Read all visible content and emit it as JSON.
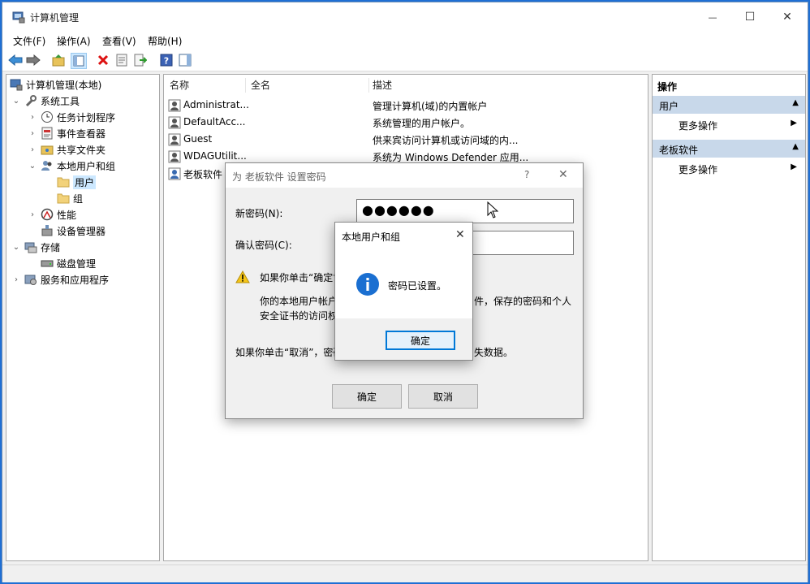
{
  "window": {
    "title": "计算机管理",
    "minimize": "—",
    "maximize": "☐",
    "close": "✕"
  },
  "menu": [
    "文件(F)",
    "操作(A)",
    "查看(V)",
    "帮助(H)"
  ],
  "tree": {
    "root": "计算机管理(本地)",
    "system_tools": "系统工具",
    "task_scheduler": "任务计划程序",
    "event_viewer": "事件查看器",
    "shared_folders": "共享文件夹",
    "local_users_groups": "本地用户和组",
    "users": "用户",
    "groups": "组",
    "performance": "性能",
    "device_manager": "设备管理器",
    "storage": "存储",
    "disk_management": "磁盘管理",
    "services_apps": "服务和应用程序"
  },
  "list": {
    "headers": [
      "名称",
      "全名",
      "描述"
    ],
    "rows": [
      {
        "name": "Administrat...",
        "fullname": "",
        "desc": "管理计算机(域)的内置帐户"
      },
      {
        "name": "DefaultAcc...",
        "fullname": "",
        "desc": "系统管理的用户帐户。"
      },
      {
        "name": "Guest",
        "fullname": "",
        "desc": "供来宾访问计算机或访问域的内..."
      },
      {
        "name": "WDAGUtilit...",
        "fullname": "",
        "desc": "系统为 Windows Defender 应用..."
      },
      {
        "name": "老板软件",
        "fullname": "",
        "desc": ""
      }
    ]
  },
  "actions": {
    "header": "操作",
    "section1": "用户",
    "more1": "更多操作",
    "section2": "老板软件",
    "more2": "更多操作"
  },
  "set_password_dialog": {
    "title": "为 老板软件 设置密码",
    "help": "?",
    "close": "✕",
    "new_password_label": "新密码(N):",
    "new_password_value": "●●●●●●",
    "confirm_label": "确认密码(C):",
    "confirm_value": "",
    "warning_line": "如果你单击“确定”",
    "info_line1_left": "你的本地用户帐户",
    "info_line1_right": "件，保存的密码和个人",
    "info_line2": "安全证书的访问权",
    "cancel_line_left": "如果你单击“取消”，密码",
    "cancel_line_right": "失数据。",
    "ok": "确定",
    "cancel": "取消"
  },
  "message_dialog": {
    "title": "本地用户和组",
    "close": "✕",
    "message": "密码已设置。",
    "ok": "确定"
  },
  "colors": {
    "accent": "#1f6fd4",
    "info_blue": "#1a6fd1",
    "selection": "#cce8ff",
    "action_section": "#c8d8ea"
  }
}
